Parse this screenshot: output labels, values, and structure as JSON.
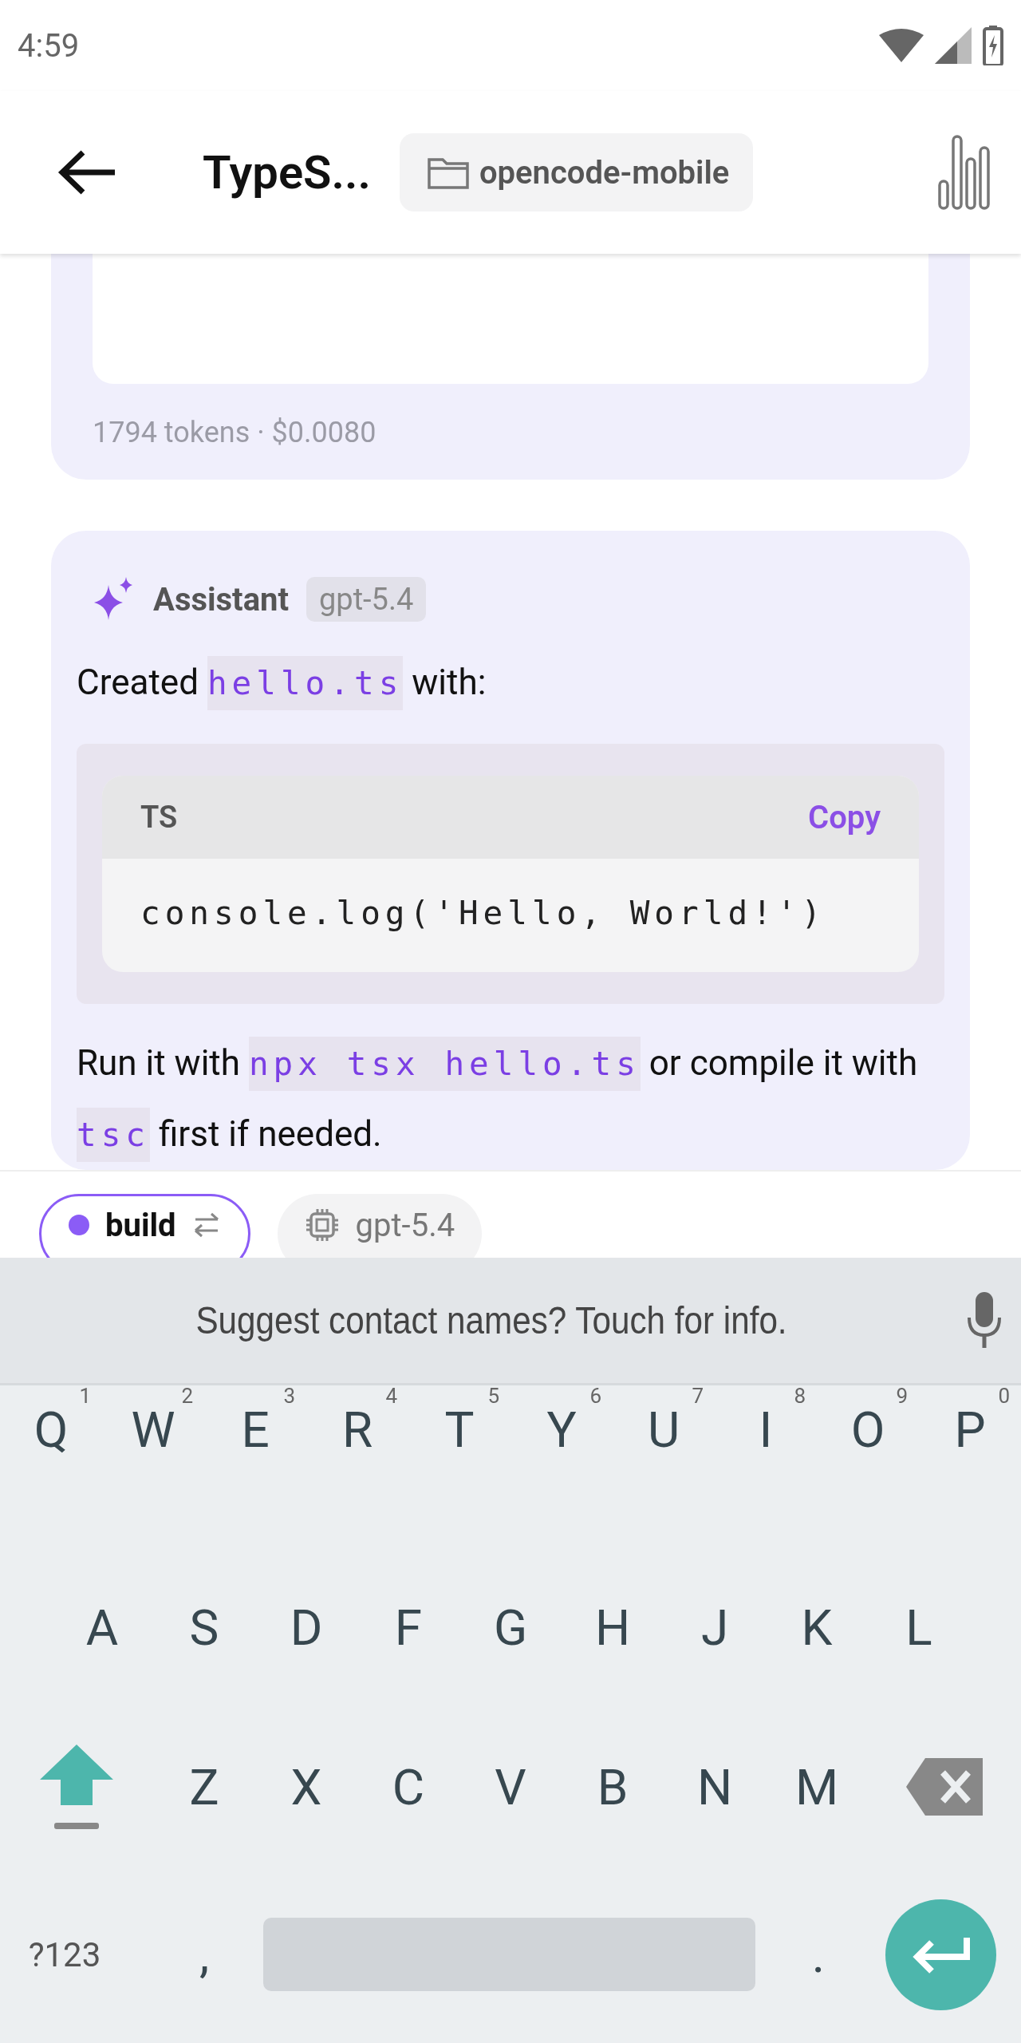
{
  "status_bar": {
    "time": "4:59"
  },
  "header": {
    "title": "TypeS...",
    "project": "opencode-mobile"
  },
  "previous_message": {
    "usage": "1794 tokens · $0.0080"
  },
  "message": {
    "role": "Assistant",
    "model": "gpt-5.4",
    "blocks": [
      {
        "kind": "paragraph",
        "parts": [
          {
            "kind": "text",
            "text": "Created "
          },
          {
            "kind": "code",
            "text": "hello.ts"
          },
          {
            "kind": "text",
            "text": " with:"
          }
        ]
      },
      {
        "kind": "code_block",
        "language": "TS",
        "action": "Copy",
        "code": "console.log('Hello, World!')"
      },
      {
        "kind": "paragraph",
        "parts": [
          {
            "kind": "text",
            "text": "Run it with "
          },
          {
            "kind": "code",
            "text": "npx tsx hello.ts"
          },
          {
            "kind": "text",
            "text": " or compile it with "
          },
          {
            "kind": "code",
            "text": "tsc"
          },
          {
            "kind": "text",
            "text": " first if needed."
          }
        ]
      }
    ]
  },
  "composer": {
    "agent": "build",
    "model": "gpt-5.4"
  },
  "keyboard": {
    "suggestion": "Suggest contact names? Touch for info.",
    "rows": [
      [
        {
          "key": "Q",
          "hint": "1"
        },
        {
          "key": "W",
          "hint": "2"
        },
        {
          "key": "E",
          "hint": "3"
        },
        {
          "key": "R",
          "hint": "4"
        },
        {
          "key": "T",
          "hint": "5"
        },
        {
          "key": "Y",
          "hint": "6"
        },
        {
          "key": "U",
          "hint": "7"
        },
        {
          "key": "I",
          "hint": "8"
        },
        {
          "key": "O",
          "hint": "9"
        },
        {
          "key": "P",
          "hint": "0"
        }
      ],
      [
        {
          "key": "A"
        },
        {
          "key": "S"
        },
        {
          "key": "D"
        },
        {
          "key": "F"
        },
        {
          "key": "G"
        },
        {
          "key": "H"
        },
        {
          "key": "J"
        },
        {
          "key": "K"
        },
        {
          "key": "L"
        }
      ],
      [
        {
          "key": "Z"
        },
        {
          "key": "X"
        },
        {
          "key": "C"
        },
        {
          "key": "V"
        },
        {
          "key": "B"
        },
        {
          "key": "N"
        },
        {
          "key": "M"
        }
      ]
    ],
    "symbols": "?123",
    "comma": ",",
    "period": "."
  }
}
